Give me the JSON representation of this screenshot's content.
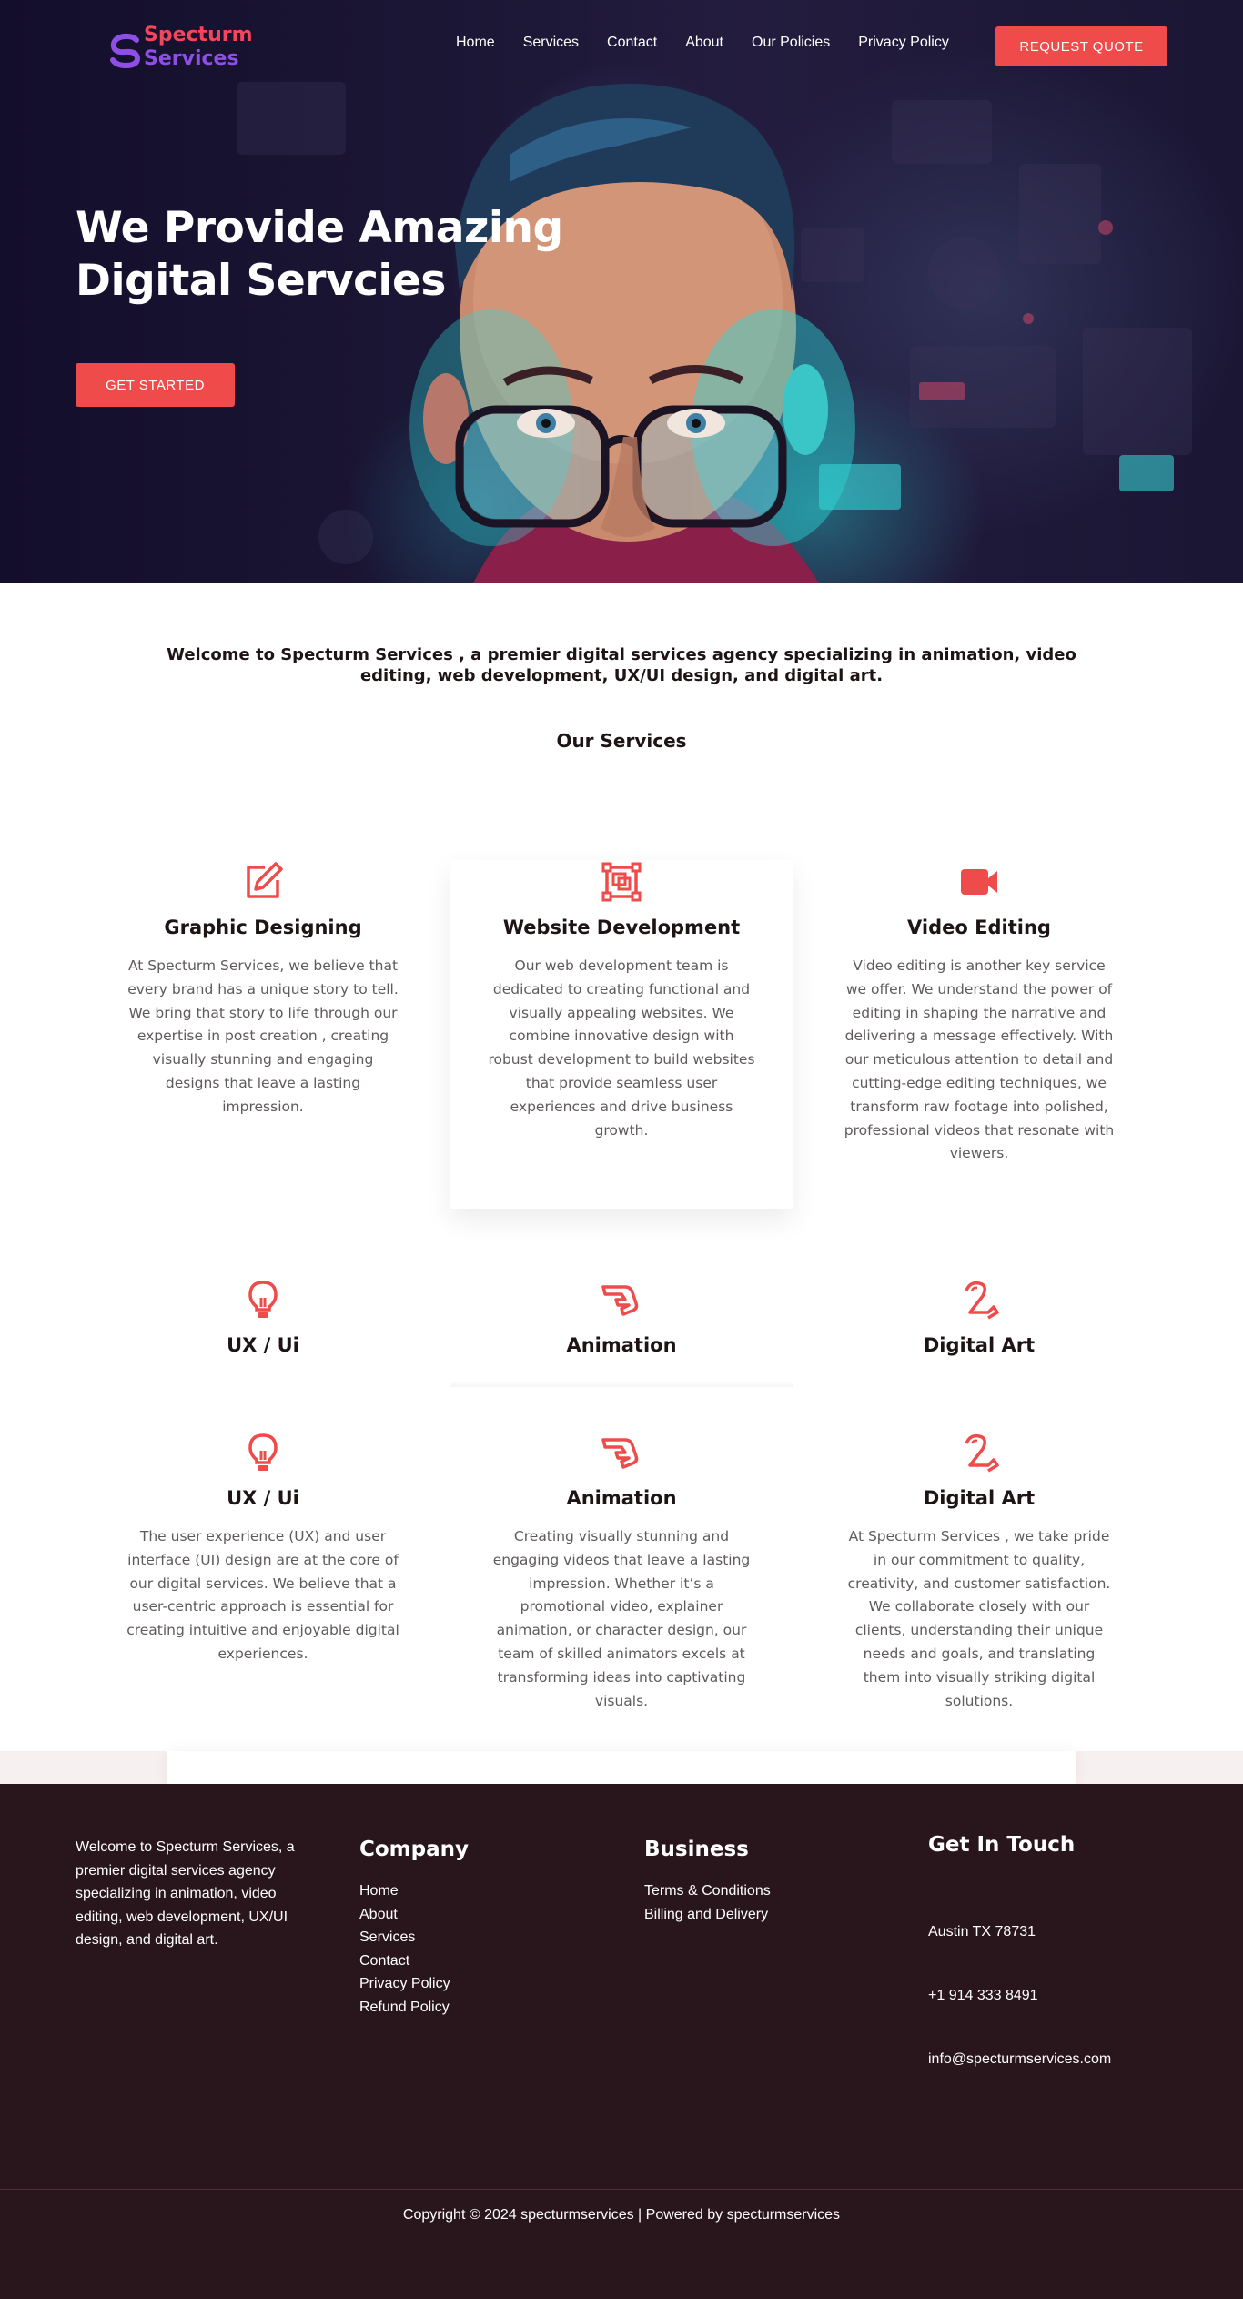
{
  "brand": {
    "name_line1": "Specturm",
    "name_line2": "Services"
  },
  "nav": {
    "items": [
      "Home",
      "Services",
      "Contact",
      "About",
      "Our Policies",
      "Privacy Policy"
    ],
    "cta": "REQUEST QUOTE"
  },
  "hero": {
    "title": "We Provide Amazing Digital Servcies",
    "button": "GET STARTED"
  },
  "intro": {
    "text": "Welcome to Specturm Services , a premier digital services agency specializing in animation, video editing, web development, UX/UI design, and digital art.",
    "services_heading": "Our Services"
  },
  "services_row1": [
    {
      "icon": "pencil-edit-icon",
      "title": "Graphic Designing",
      "description": "At Specturm Services, we believe that every brand has a unique story to tell. We bring that story to life through our expertise in post creation , creating visually stunning and engaging designs that leave a lasting impression."
    },
    {
      "icon": "layout-frame-icon",
      "title": "Website Development",
      "description": "Our web development team is dedicated to creating functional and visually appealing websites. We combine innovative design with robust development to build websites that provide seamless user experiences and drive business growth."
    },
    {
      "icon": "video-camera-icon",
      "title": "Video Editing",
      "description": "Video editing is another key service we offer. We understand the power of editing in shaping the narrative and delivering a message effectively. With our meticulous attention to detail and cutting-edge editing techniques, we transform raw footage into polished, professional videos that resonate with viewers."
    }
  ],
  "services_row2": [
    {
      "icon": "lightbulb-icon",
      "title": "UX / Ui"
    },
    {
      "icon": "animation-icon",
      "title": "Animation"
    },
    {
      "icon": "digital-art-icon",
      "title": "Digital Art"
    }
  ],
  "services_row3": [
    {
      "icon": "lightbulb-icon",
      "title": "UX / Ui",
      "description": "The user experience (UX) and user interface (UI) design are at the core of our digital services. We believe that a user-centric approach is essential for creating intuitive and enjoyable digital experiences."
    },
    {
      "icon": "animation-icon",
      "title": "Animation",
      "description": "Creating visually stunning and engaging videos that leave a lasting impression. Whether it’s a promotional video, explainer animation, or character design, our team of skilled animators excels at transforming ideas into captivating visuals."
    },
    {
      "icon": "digital-art-icon",
      "title": "Digital Art",
      "description": "At Specturm Services , we take pride in our commitment to quality, creativity, and customer satisfaction. We collaborate closely with our clients, understanding their unique needs and goals, and translating them into visually striking digital solutions."
    }
  ],
  "footer": {
    "about": "Welcome to Specturm Services, a premier digital services agency specializing in animation, video editing, web development, UX/UI design, and digital art.",
    "company_heading": "Company",
    "company_links": [
      "Home",
      "About",
      "Services",
      "Contact",
      "Privacy Policy",
      "Refund Policy"
    ],
    "business_heading": "Business",
    "business_links": [
      "Terms & Conditions",
      "Billing and Delivery"
    ],
    "contact_heading": "Get In Touch",
    "address": "Austin TX 78731",
    "phone": "+1 914 333 8491",
    "email": "info@specturmservices.com",
    "copyright": "Copyright © 2024 specturmservices | Powered by specturmservices"
  },
  "colors": {
    "accent": "#ef4b4b",
    "brand_red": "#f2475a",
    "brand_purple": "#8e4fe6",
    "footer_bg": "#29161c",
    "hero_bg": "#130e2c"
  }
}
